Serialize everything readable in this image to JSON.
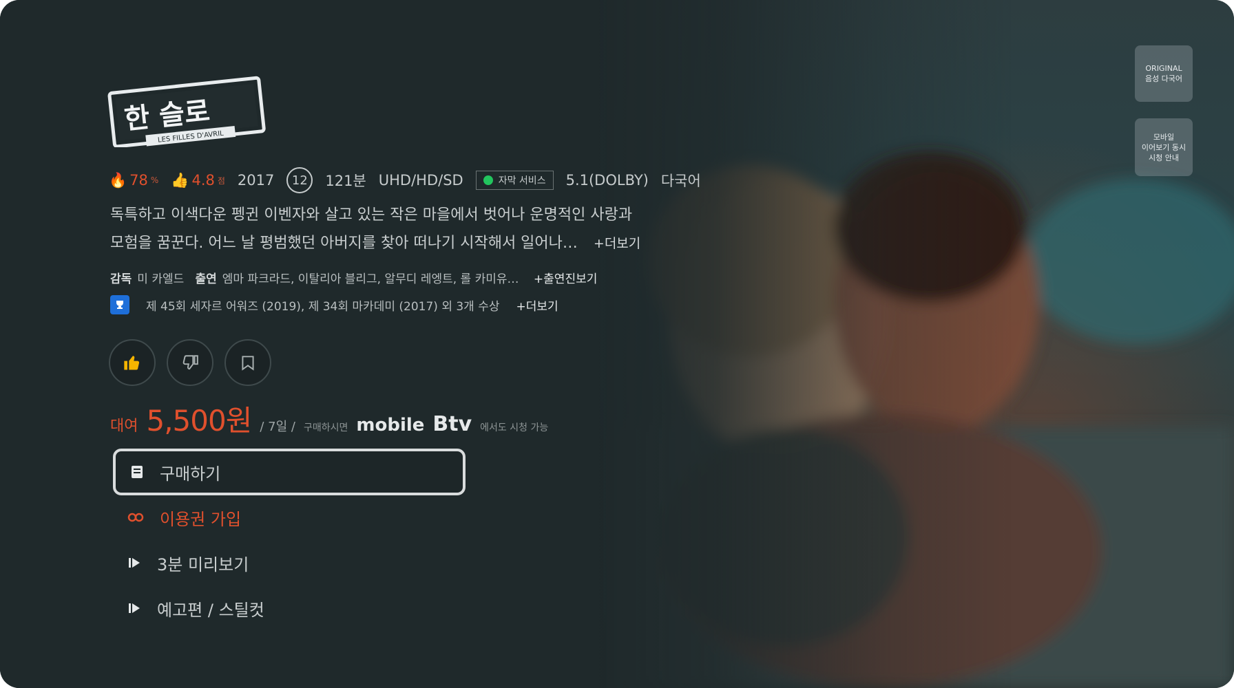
{
  "title_logo": {
    "main": "한 슬로",
    "sub": "LES FILLES D'AVRIL"
  },
  "side_buttons": [
    {
      "label_line1": "ORIGINAL",
      "label_line2": "음성 다국어"
    },
    {
      "label_line1": "모바일",
      "label_line2": "이어보기 동시",
      "label_line3": "시청 안내"
    }
  ],
  "meta": {
    "like": "78",
    "like_unit": "%",
    "rating": "4.8",
    "rating_unit": "점",
    "year": "2017",
    "age": "12",
    "duration": "121분",
    "quality": "UHD/HD/SD",
    "subtitle_badge": "자막 서비스",
    "audio": "5.1(DOLBY)",
    "language": "다국어"
  },
  "description": {
    "line1": "독특하고 이색다운 펭귄 이벤자와 살고 있는 작은 마을에서 벗어나 운명적인 사랑과",
    "line2": "모험을 꿈꾼다. 어느 날 평범했던 아버지를 찾아 떠나기 시작해서 일어나…",
    "more": "+더보기"
  },
  "credits": {
    "director_label": "감독",
    "director": "미 카엘드",
    "cast_label": "출연",
    "cast": "엠마 파크라드, 이탈리아 블리그, 알무디 레엥트, 롤 카미유…",
    "more": "+출연진보기"
  },
  "awards": {
    "text": "제 45회 세자르 어워즈 (2019), 제 34회 마카데미 (2017) 외 3개 수상",
    "more": "+더보기"
  },
  "action_icons": [
    {
      "name": "thumbs-up-icon"
    },
    {
      "name": "thumbs-down-icon"
    },
    {
      "name": "bookmark-icon"
    }
  ],
  "price": {
    "label": "대여",
    "amount": "5,500원",
    "period": "/ 7일 /",
    "device_note": "구매하시면",
    "mobile": "mobile",
    "btv": "Btv",
    "extra": "에서도 시청 가능"
  },
  "menu": [
    {
      "label": "구매하기",
      "icon": "purchase-icon"
    },
    {
      "label": "이용권 가입",
      "icon": "pass-icon"
    },
    {
      "label": "3분 미리보기",
      "icon": "play-icon"
    },
    {
      "label": "예고편 / 스틸컷",
      "icon": "play-icon"
    }
  ],
  "colors": {
    "accent": "#e0502d",
    "background": "#1f292b",
    "focus_border": "#d9dcdd",
    "award_badge": "#1e6fd9",
    "subtitle_dot": "#22c55e"
  }
}
